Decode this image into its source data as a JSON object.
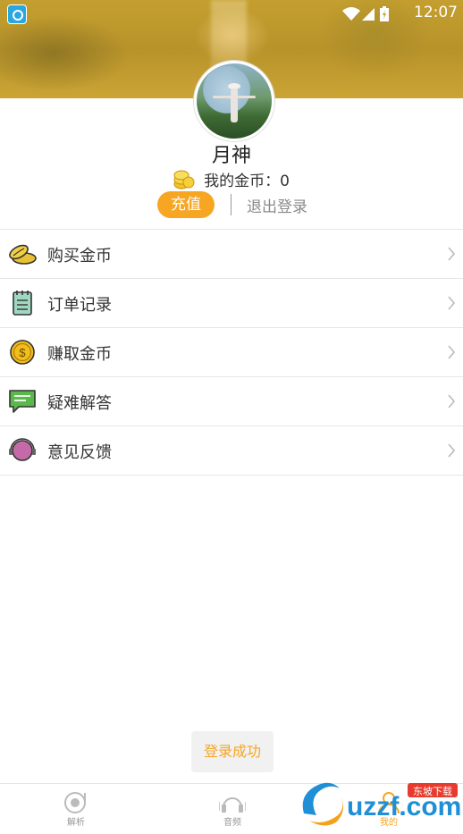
{
  "status_bar": {
    "time": "12:07"
  },
  "profile": {
    "username": "月神",
    "coins_label": "我的金币：0",
    "recharge_label": "充值",
    "logout_label": "退出登录"
  },
  "menu": {
    "items": [
      {
        "label": "购买金币",
        "icon": "gold-coins-icon"
      },
      {
        "label": "订单记录",
        "icon": "notepad-icon"
      },
      {
        "label": "赚取金币",
        "icon": "dollar-coin-icon"
      },
      {
        "label": "疑难解答",
        "icon": "chat-bubble-icon"
      },
      {
        "label": "意见反馈",
        "icon": "headset-icon"
      }
    ]
  },
  "toast": {
    "text": "登录成功"
  },
  "bottom_nav": {
    "items": [
      {
        "label": "解析",
        "icon": "record-icon"
      },
      {
        "label": "音频",
        "icon": "headphones-icon"
      },
      {
        "label": "我的",
        "icon": "profile-icon",
        "active": true
      }
    ]
  },
  "watermark": {
    "text": "uzzf.com",
    "badge": "东坡下载"
  },
  "colors": {
    "accent": "#f6a623",
    "banner": "#c49f2f"
  }
}
